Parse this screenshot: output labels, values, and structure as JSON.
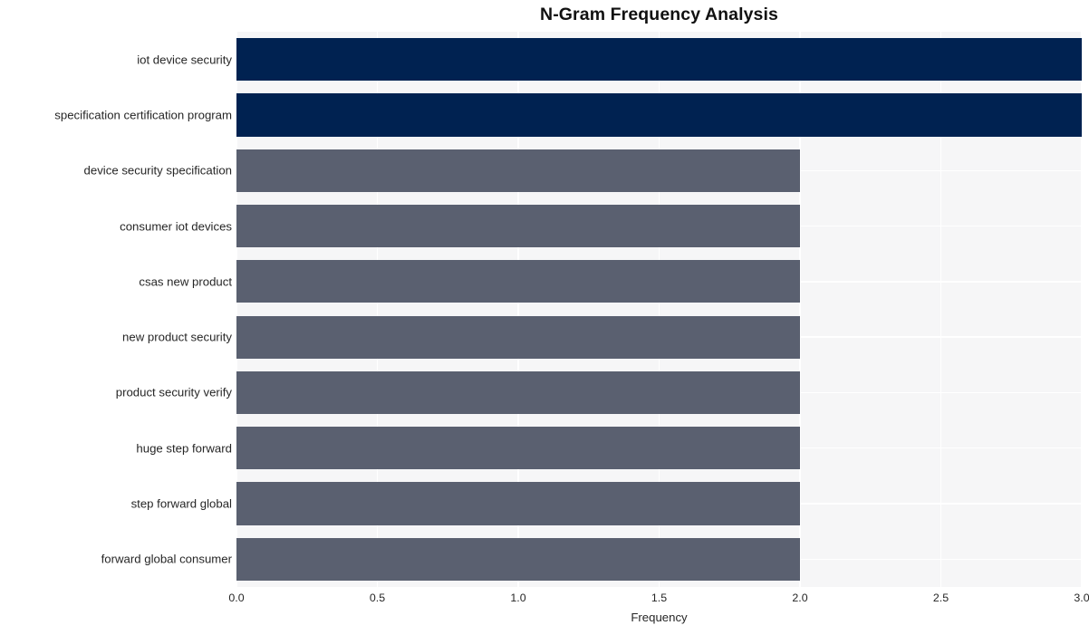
{
  "chart_data": {
    "type": "bar",
    "orientation": "horizontal",
    "title": "N-Gram Frequency Analysis",
    "xlabel": "Frequency",
    "ylabel": "",
    "xlim": [
      0.0,
      3.0
    ],
    "xticks": [
      "0.0",
      "0.5",
      "1.0",
      "1.5",
      "2.0",
      "2.5",
      "3.0"
    ],
    "xtick_values": [
      0.0,
      0.5,
      1.0,
      1.5,
      2.0,
      2.5,
      3.0
    ],
    "grid": true,
    "legend": "none",
    "categories": [
      "iot device security",
      "specification certification program",
      "device security specification",
      "consumer iot devices",
      "csas new product",
      "new product security",
      "product security verify",
      "huge step forward",
      "step forward global",
      "forward global consumer"
    ],
    "values": [
      3,
      3,
      2,
      2,
      2,
      2,
      2,
      2,
      2,
      2
    ],
    "bar_colors": [
      "#002251",
      "#002251",
      "#5a6070",
      "#5a6070",
      "#5a6070",
      "#5a6070",
      "#5a6070",
      "#5a6070",
      "#5a6070",
      "#5a6070"
    ]
  },
  "style": {
    "plot_background": "#f6f6f7",
    "grid_color": "#ffffff",
    "text_color": "#262626",
    "title_color": "#111111",
    "figure_background": "#ffffff",
    "accent_high": "#002251",
    "accent_low": "#5a6070"
  }
}
